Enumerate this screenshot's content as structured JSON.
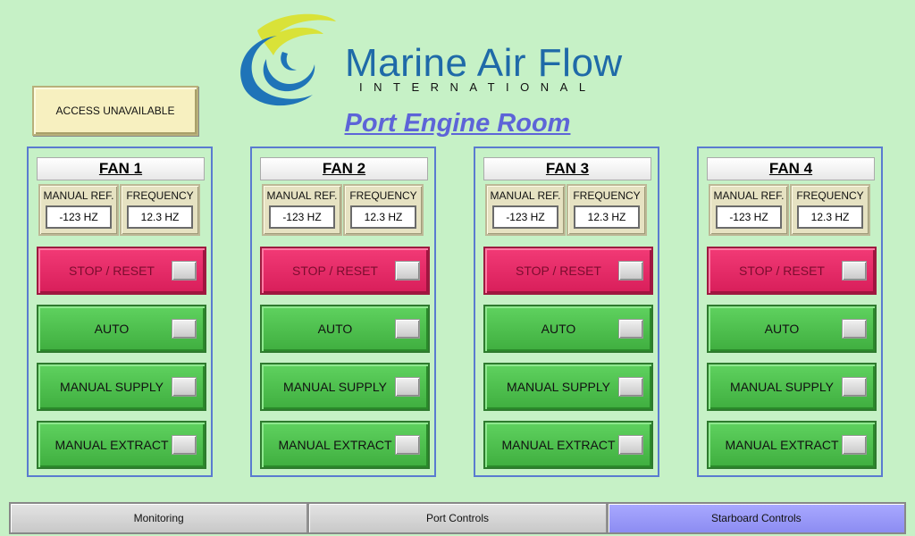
{
  "logo": {
    "name": "Marine Air Flow",
    "subtitle": "INTERNATIONAL"
  },
  "access": {
    "label": "ACCESS UNAVAILABLE"
  },
  "page": {
    "title": "Port Engine Room"
  },
  "fans": [
    {
      "name": "FAN 1",
      "manual_ref_label": "MANUAL REF.",
      "manual_ref_value": "-123 HZ",
      "frequency_label": "FREQUENCY",
      "frequency_value": "12.3 HZ",
      "buttons": {
        "stop": "STOP / RESET",
        "auto": "AUTO",
        "supply": "MANUAL SUPPLY",
        "extract": "MANUAL EXTRACT"
      }
    },
    {
      "name": "FAN 2",
      "manual_ref_label": "MANUAL REF.",
      "manual_ref_value": "-123 HZ",
      "frequency_label": "FREQUENCY",
      "frequency_value": "12.3 HZ",
      "buttons": {
        "stop": "STOP / RESET",
        "auto": "AUTO",
        "supply": "MANUAL SUPPLY",
        "extract": "MANUAL EXTRACT"
      }
    },
    {
      "name": "FAN 3",
      "manual_ref_label": "MANUAL REF.",
      "manual_ref_value": "-123 HZ",
      "frequency_label": "FREQUENCY",
      "frequency_value": "12.3 HZ",
      "buttons": {
        "stop": "STOP / RESET",
        "auto": "AUTO",
        "supply": "MANUAL SUPPLY",
        "extract": "MANUAL EXTRACT"
      }
    },
    {
      "name": "FAN 4",
      "manual_ref_label": "MANUAL REF.",
      "manual_ref_value": "-123 HZ",
      "frequency_label": "FREQUENCY",
      "frequency_value": "12.3 HZ",
      "buttons": {
        "stop": "STOP / RESET",
        "auto": "AUTO",
        "supply": "MANUAL SUPPLY",
        "extract": "MANUAL EXTRACT"
      }
    }
  ],
  "nav": {
    "tabs": [
      {
        "label": "Monitoring"
      },
      {
        "label": "Port Controls"
      },
      {
        "label": "Starboard Controls"
      }
    ]
  },
  "colors": {
    "background": "#c6f1c6",
    "stop_button": "#e42566",
    "mode_button": "#4cc24c",
    "active_tab": "#9c9cf8",
    "title": "#5d64d8"
  }
}
